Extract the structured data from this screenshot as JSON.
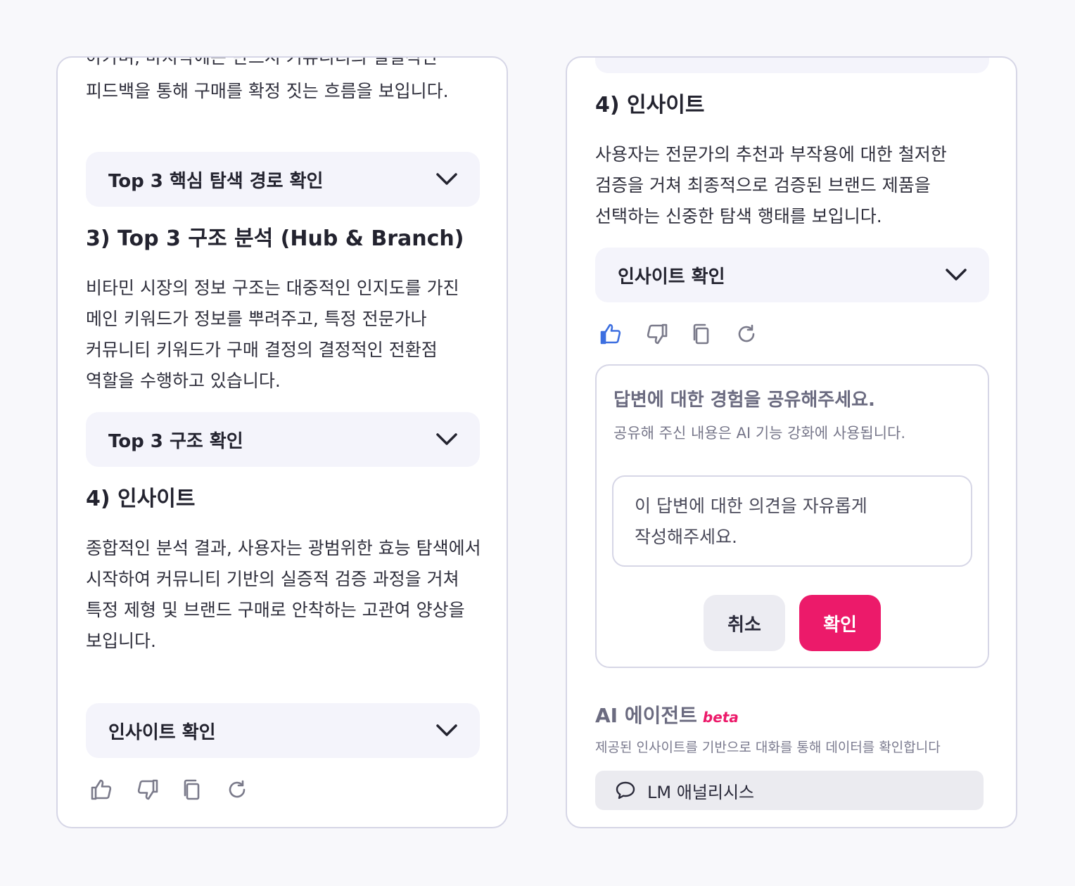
{
  "left_panel": {
    "intro_cutoff_line": "아가며, 마지막에는 반드시 커뮤니티의 실질적인",
    "intro_paragraph": "피드백을 통해 구매를 확정 짓는 흐름을 보입니다.",
    "accordion_paths": "Top 3 핵심 탐색 경로 확인",
    "section3_heading": "3) Top 3 구조 분석 (Hub & Branch)",
    "section3_paragraph": "비타민 시장의 정보 구조는 대중적인 인지도를 가진 메인 키워드가 정보를 뿌려주고, 특정 전문가나 커뮤니티 키워드가 구매 결정의 결정적인 전환점 역할을 수행하고 있습니다.",
    "accordion_structure": "Top 3 구조 확인",
    "section4_heading": "4) 인사이트",
    "section4_paragraph": "종합적인 분석 결과, 사용자는 광범위한 효능 탐색에서 시작하여 커뮤니티 기반의 실증적 검증 과정을 거쳐 특정 제형 및 브랜드 구매로 안착하는 고관여 양상을 보입니다.",
    "accordion_insight": "인사이트 확인",
    "actions": [
      "thumbs-up-icon",
      "thumbs-down-icon",
      "copy-icon",
      "regenerate-icon"
    ]
  },
  "right_panel": {
    "section4_heading": "4) 인사이트",
    "section4_paragraph": "사용자는 전문가의 추천과 부작용에 대한 철저한 검증을 거쳐 최종적으로 검증된 브랜드 제품을 선택하는 신중한 탐색 행태를 보입니다.",
    "accordion_insight": "인사이트 확인",
    "thumbs_up_active": true,
    "feedback": {
      "title": "답변에 대한 경험을 공유해주세요.",
      "subtitle": "공유해 주신 내용은 AI 기능 강화에 사용됩니다.",
      "placeholder": "이 답변에 대한 의견을 자유롭게 작성해주세요.",
      "cancel_label": "취소",
      "confirm_label": "확인"
    },
    "agent": {
      "title": "AI 에이전트",
      "beta": "beta",
      "description": "제공된 인사이트를 기반으로 대화를 통해 데이터를 확인합니다",
      "button_label": "LM 애널리시스"
    }
  },
  "colors": {
    "accent_pink": "#ec1a6a",
    "active_icon_blue": "#3d6fe0",
    "border": "#d6d6e6",
    "accordion_bg": "#f4f4fb"
  }
}
